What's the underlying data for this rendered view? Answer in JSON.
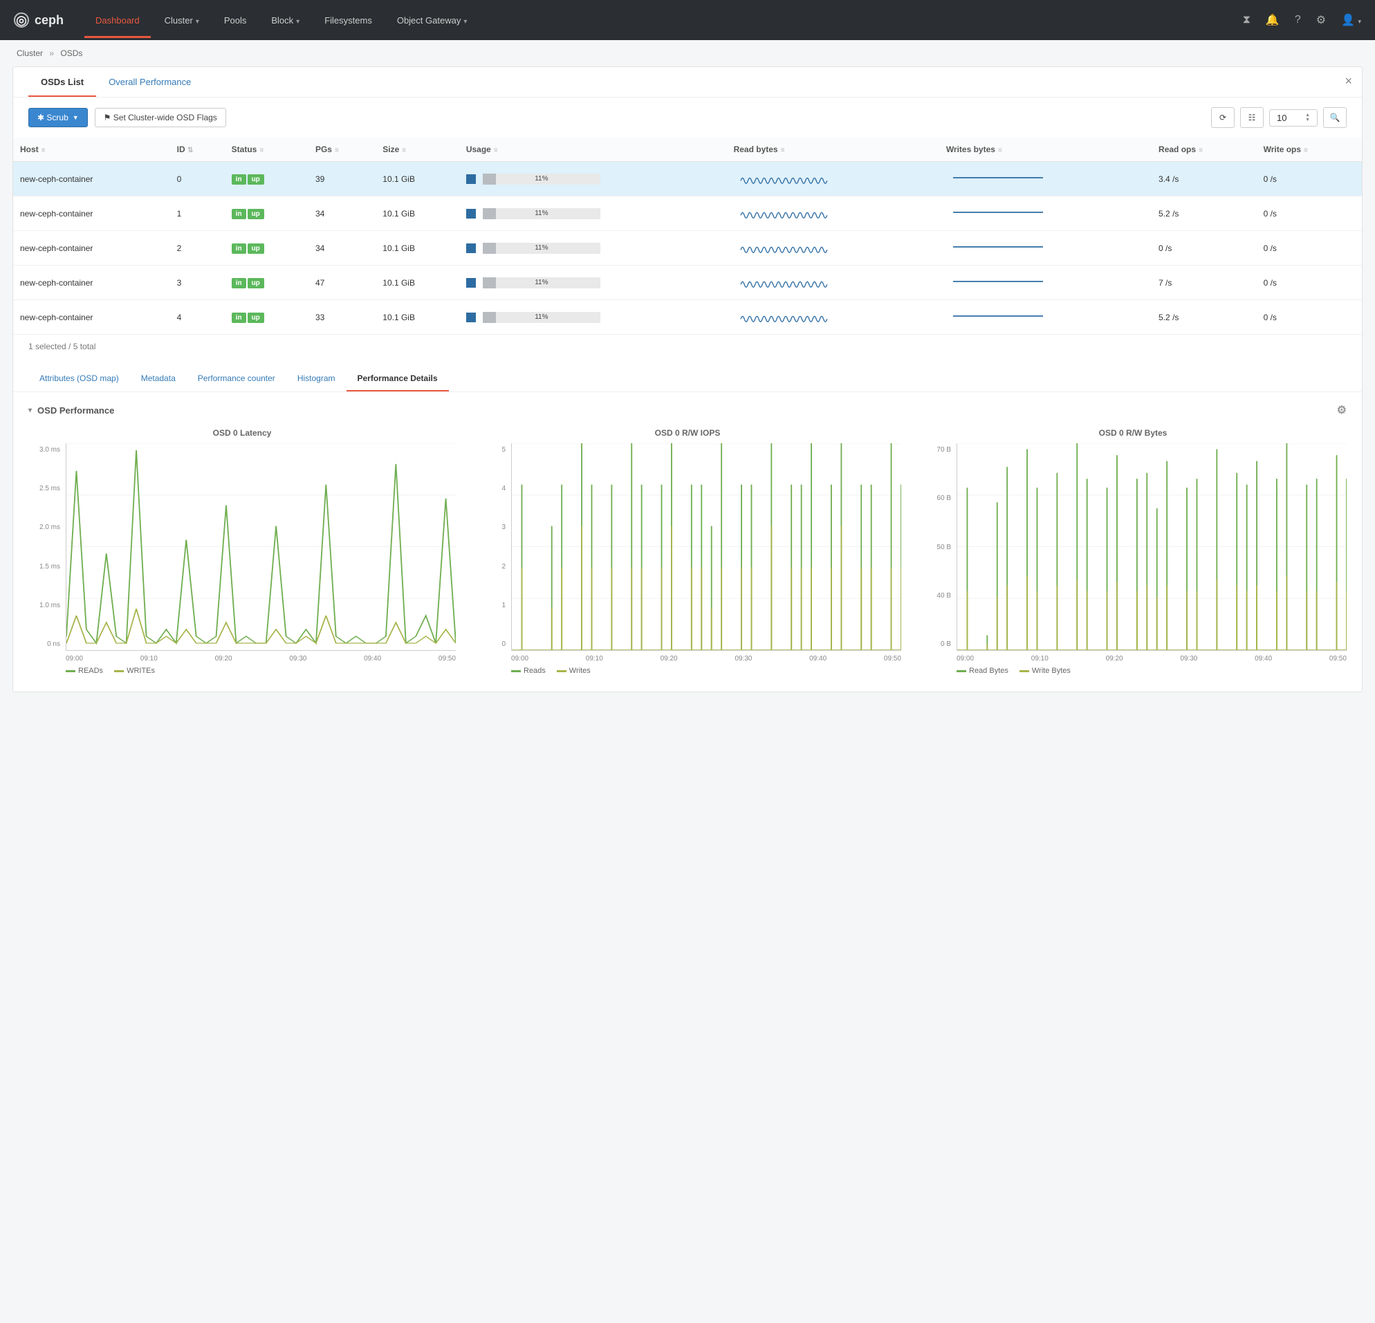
{
  "brand": "ceph",
  "nav": {
    "items": [
      {
        "label": "Dashboard",
        "active": true,
        "dropdown": false
      },
      {
        "label": "Cluster",
        "active": false,
        "dropdown": true
      },
      {
        "label": "Pools",
        "active": false,
        "dropdown": false
      },
      {
        "label": "Block",
        "active": false,
        "dropdown": true
      },
      {
        "label": "Filesystems",
        "active": false,
        "dropdown": false
      },
      {
        "label": "Object Gateway",
        "active": false,
        "dropdown": true
      }
    ],
    "icons": {
      "tasks": "⧗",
      "notif": "🔔",
      "help": "?",
      "gear": "⚙",
      "user": "👤"
    }
  },
  "breadcrumb": {
    "a": "Cluster",
    "b": "OSDs"
  },
  "tabs": {
    "list": "OSDs List",
    "overall": "Overall Performance"
  },
  "toolbar": {
    "scrub": "✱ Scrub",
    "flags": "⚑ Set Cluster-wide OSD Flags",
    "page_size": "10"
  },
  "columns": {
    "host": "Host",
    "id": "ID",
    "sel": "",
    "status": "Status",
    "pgs": "PGs",
    "size": "Size",
    "usage": "Usage",
    "read_bytes": "Read bytes",
    "writes_bytes": "Writes bytes",
    "read_ops": "Read ops",
    "write_ops": "Write ops",
    "sort": "≡"
  },
  "rows": [
    {
      "host": "new-ceph-container",
      "id": "0",
      "pgs": "39",
      "size": "10.1 GiB",
      "usage": 11,
      "read_ops": "3.4 /s",
      "write_ops": "0 /s",
      "selected": true
    },
    {
      "host": "new-ceph-container",
      "id": "1",
      "pgs": "34",
      "size": "10.1 GiB",
      "usage": 11,
      "read_ops": "5.2 /s",
      "write_ops": "0 /s",
      "selected": false
    },
    {
      "host": "new-ceph-container",
      "id": "2",
      "pgs": "34",
      "size": "10.1 GiB",
      "usage": 11,
      "read_ops": "0 /s",
      "write_ops": "0 /s",
      "selected": false
    },
    {
      "host": "new-ceph-container",
      "id": "3",
      "pgs": "47",
      "size": "10.1 GiB",
      "usage": 11,
      "read_ops": "7 /s",
      "write_ops": "0 /s",
      "selected": false
    },
    {
      "host": "new-ceph-container",
      "id": "4",
      "pgs": "33",
      "size": "10.1 GiB",
      "usage": 11,
      "read_ops": "5.2 /s",
      "write_ops": "0 /s",
      "selected": false
    }
  ],
  "status_badges": {
    "a": "in",
    "b": "up"
  },
  "footer_note": "1 selected / 5 total",
  "subtabs": {
    "attr": "Attributes (OSD map)",
    "meta": "Metadata",
    "perfcnt": "Performance counter",
    "hist": "Histogram",
    "perfdet": "Performance Details"
  },
  "perf_section_title": "OSD Performance",
  "panels": {
    "latency": {
      "title": "OSD 0 Latency",
      "legend_a": "READs",
      "legend_b": "WRITEs"
    },
    "iops": {
      "title": "OSD 0 R/W IOPS",
      "legend_a": "Reads",
      "legend_b": "Writes"
    },
    "bytes": {
      "title": "OSD 0 R/W Bytes",
      "legend_a": "Read Bytes",
      "legend_b": "Write Bytes"
    }
  },
  "chart_data": [
    {
      "type": "line",
      "title": "OSD 0 Latency",
      "xlabel": "",
      "ylabel": "",
      "x_ticks": [
        "09:00",
        "09:10",
        "09:20",
        "09:30",
        "09:40",
        "09:50"
      ],
      "y_ticks": [
        "0 ns",
        "1.0 ms",
        "1.5 ms",
        "2.0 ms",
        "2.5 ms",
        "3.0 ms"
      ],
      "ylim": [
        0,
        3.0
      ],
      "series": [
        {
          "name": "READs",
          "unit": "ms",
          "values": [
            0.2,
            2.6,
            0.3,
            0.1,
            1.4,
            0.2,
            0.1,
            2.9,
            0.2,
            0.1,
            0.3,
            0.1,
            1.6,
            0.2,
            0.1,
            0.2,
            2.1,
            0.1,
            0.2,
            0.1,
            0.1,
            1.8,
            0.2,
            0.1,
            0.3,
            0.1,
            2.4,
            0.2,
            0.1,
            0.2,
            0.1,
            0.1,
            0.2,
            2.7,
            0.1,
            0.2,
            0.5,
            0.1,
            2.2,
            0.1
          ]
        },
        {
          "name": "WRITEs",
          "unit": "ms",
          "values": [
            0.1,
            0.5,
            0.1,
            0.1,
            0.4,
            0.1,
            0.1,
            0.6,
            0.1,
            0.1,
            0.2,
            0.1,
            0.3,
            0.1,
            0.1,
            0.1,
            0.4,
            0.1,
            0.1,
            0.1,
            0.1,
            0.3,
            0.1,
            0.1,
            0.2,
            0.1,
            0.5,
            0.1,
            0.1,
            0.1,
            0.1,
            0.1,
            0.1,
            0.4,
            0.1,
            0.1,
            0.2,
            0.1,
            0.3,
            0.1
          ]
        }
      ]
    },
    {
      "type": "line",
      "title": "OSD 0 R/W IOPS",
      "x_ticks": [
        "09:00",
        "09:10",
        "09:20",
        "09:30",
        "09:40",
        "09:50"
      ],
      "y_ticks": [
        "0",
        "1",
        "2",
        "3",
        "4",
        "5"
      ],
      "ylim": [
        0,
        5
      ],
      "series": [
        {
          "name": "Reads",
          "values": [
            0,
            4,
            0,
            0,
            3,
            4,
            0,
            5,
            4,
            0,
            4,
            0,
            5,
            4,
            0,
            4,
            5,
            0,
            4,
            4,
            3,
            5,
            0,
            4,
            4,
            0,
            5,
            0,
            4,
            4,
            5,
            0,
            4,
            5,
            0,
            4,
            4,
            0,
            5,
            4
          ]
        },
        {
          "name": "Writes",
          "values": [
            0,
            2,
            0,
            0,
            1,
            2,
            0,
            3,
            2,
            0,
            2,
            0,
            2,
            2,
            0,
            2,
            3,
            0,
            2,
            2,
            1,
            2,
            0,
            2,
            2,
            0,
            3,
            0,
            2,
            2,
            2,
            0,
            2,
            3,
            0,
            2,
            2,
            0,
            2,
            2
          ]
        }
      ]
    },
    {
      "type": "line",
      "title": "OSD 0 R/W Bytes",
      "x_ticks": [
        "09:00",
        "09:10",
        "09:20",
        "09:30",
        "09:40",
        "09:50"
      ],
      "y_ticks": [
        "0 B",
        "40 B",
        "50 B",
        "60 B",
        "70 B"
      ],
      "ylim": [
        0,
        70
      ],
      "series": [
        {
          "name": "Read Bytes",
          "unit": "B",
          "values": [
            0,
            55,
            0,
            5,
            50,
            62,
            0,
            68,
            55,
            0,
            60,
            0,
            70,
            58,
            0,
            55,
            66,
            0,
            58,
            60,
            48,
            64,
            0,
            55,
            58,
            0,
            68,
            0,
            60,
            56,
            64,
            0,
            58,
            70,
            0,
            56,
            58,
            0,
            66,
            58
          ]
        },
        {
          "name": "Write Bytes",
          "unit": "B",
          "values": [
            0,
            20,
            0,
            2,
            18,
            22,
            0,
            25,
            20,
            0,
            22,
            0,
            24,
            20,
            0,
            20,
            23,
            0,
            20,
            22,
            18,
            22,
            0,
            20,
            20,
            0,
            24,
            0,
            22,
            20,
            22,
            0,
            20,
            25,
            0,
            20,
            20,
            0,
            23,
            20
          ]
        }
      ]
    }
  ]
}
